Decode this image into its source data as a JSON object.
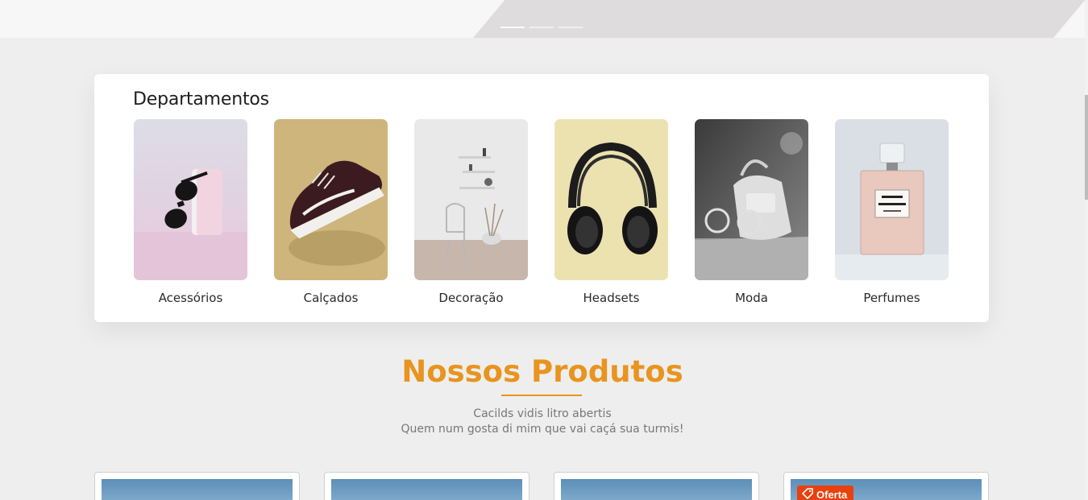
{
  "departments": {
    "title": "Departamentos",
    "items": [
      {
        "label": "Acessórios",
        "icon": "sunglasses"
      },
      {
        "label": "Calçados",
        "icon": "sneaker"
      },
      {
        "label": "Decoração",
        "icon": "shelf-decor"
      },
      {
        "label": "Headsets",
        "icon": "headphones"
      },
      {
        "label": "Moda",
        "icon": "handbag"
      },
      {
        "label": "Perfumes",
        "icon": "perfume-bottle"
      }
    ]
  },
  "products": {
    "title": "Nossos Produtos",
    "subtitle_line1": "Cacilds vidis litro abertis",
    "subtitle_line2": "Quem num gosta di mim que vai caçá sua turmis!",
    "offer_label": "Oferta"
  },
  "colors": {
    "accent": "#e8941f",
    "offer": "#e8400e",
    "background": "#eeeeee"
  }
}
